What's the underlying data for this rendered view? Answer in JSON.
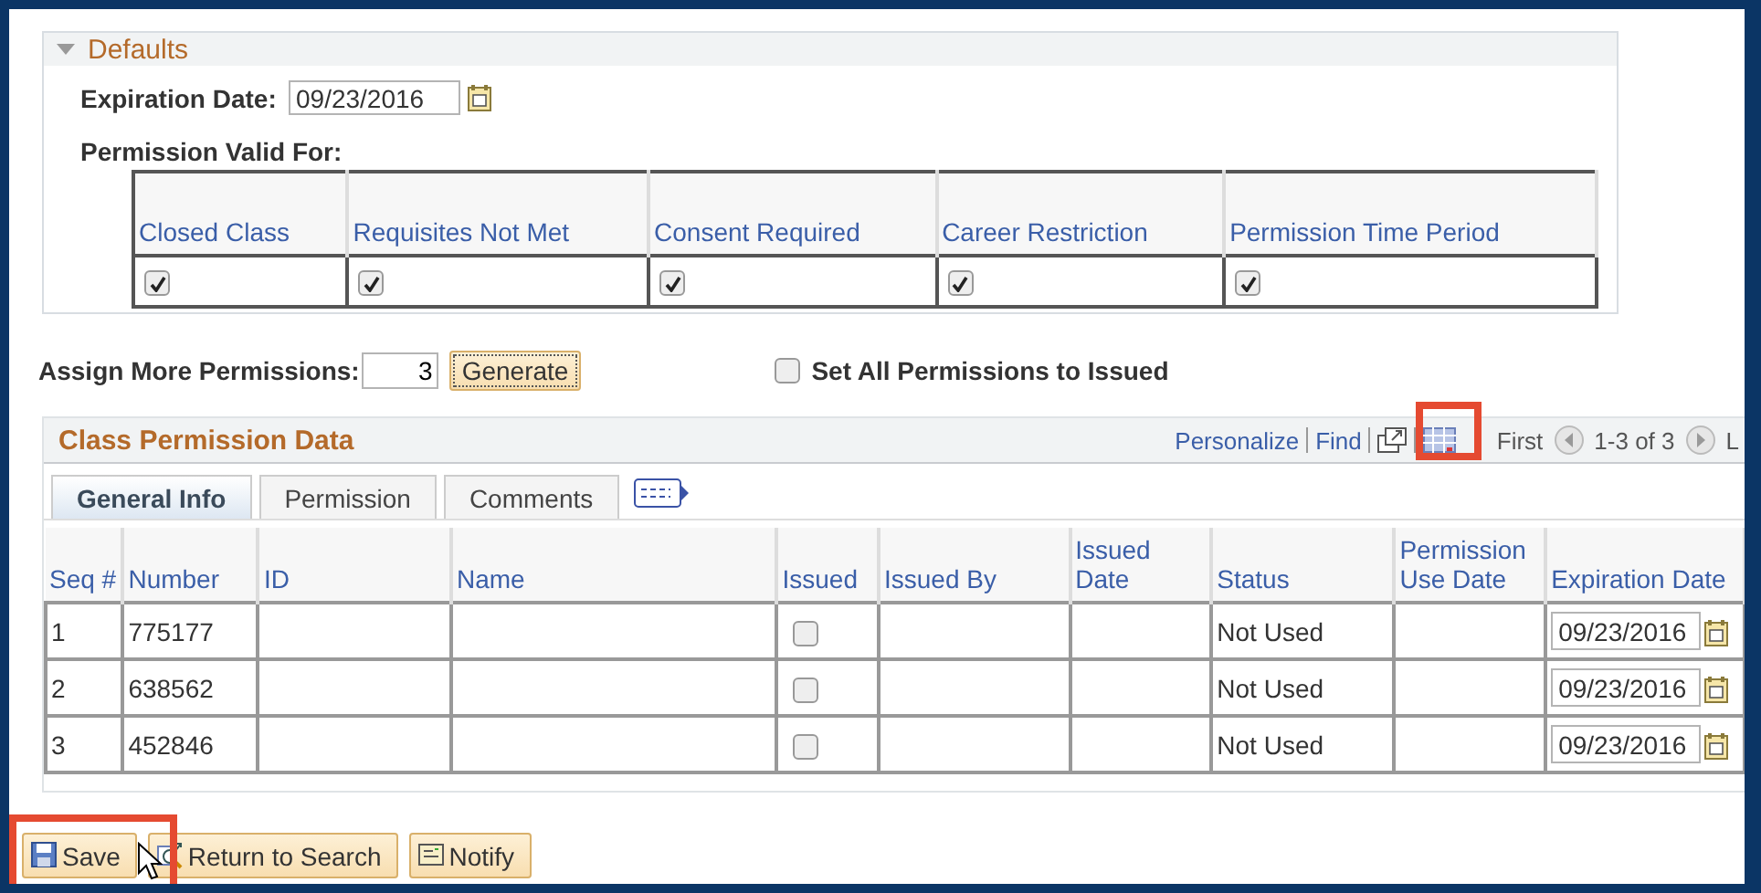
{
  "defaults": {
    "title": "Defaults",
    "expanded": true,
    "expiration_label": "Expiration Date:",
    "expiration_value": "09/23/2016",
    "valid_for_label": "Permission Valid For:",
    "valid_for": [
      {
        "label": "Closed Class",
        "checked": true
      },
      {
        "label": "Requisites Not Met",
        "checked": true
      },
      {
        "label": "Consent Required",
        "checked": true
      },
      {
        "label": "Career Restriction",
        "checked": true
      },
      {
        "label": "Permission Time Period",
        "checked": true
      }
    ]
  },
  "assign": {
    "label": "Assign More Permissions:",
    "value": "3",
    "button": "Generate"
  },
  "set_all": {
    "label": "Set All Permissions to Issued",
    "checked": false
  },
  "grid": {
    "title": "Class Permission Data",
    "links": [
      "Personalize",
      "Find"
    ],
    "first": "First",
    "range": "1-3 of 3",
    "last": "L",
    "tabs": [
      {
        "label": "General Info",
        "selected": true
      },
      {
        "label": "Permission",
        "selected": false
      },
      {
        "label": "Comments",
        "selected": false
      }
    ],
    "columns": [
      "Seq #",
      "Number",
      "ID",
      "Name",
      "Issued",
      "Issued By",
      "Issued Date",
      "Status",
      "Permission Use Date",
      "Expiration Date"
    ],
    "rows": [
      {
        "seq": "1",
        "number": "775177",
        "issued": false,
        "status": "Not Used",
        "expiration": "09/23/2016"
      },
      {
        "seq": "2",
        "number": "638562",
        "issued": false,
        "status": "Not Used",
        "expiration": "09/23/2016"
      },
      {
        "seq": "3",
        "number": "452846",
        "issued": false,
        "status": "Not Used",
        "expiration": "09/23/2016"
      }
    ]
  },
  "buttons": [
    {
      "kind": "save",
      "label": "Save"
    },
    {
      "kind": "search",
      "label": "Return to Search"
    },
    {
      "kind": "notify",
      "label": "Notify"
    }
  ]
}
